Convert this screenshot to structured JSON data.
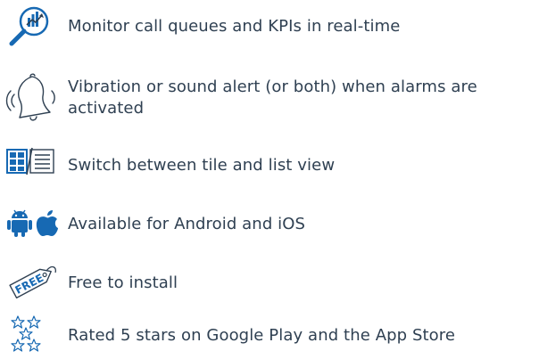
{
  "features": [
    {
      "icon": "search-chart-icon",
      "text": "Monitor call queues and KPIs in real-time"
    },
    {
      "icon": "bell-icon",
      "text": "Vibration or sound alert (or both) when alarms are activated"
    },
    {
      "icon": "tile-list-view-icon",
      "text": "Switch between tile and list view"
    },
    {
      "icon": "android-apple-icon",
      "text": "Available for Android and iOS"
    },
    {
      "icon": "free-tag-icon",
      "text": "Free to install"
    },
    {
      "icon": "stars-icon",
      "text": "Rated 5 stars on Google Play and the App Store"
    }
  ],
  "colors": {
    "text": "#2f4052",
    "icon_blue": "#1769b3",
    "icon_outline": "#2f4052"
  }
}
